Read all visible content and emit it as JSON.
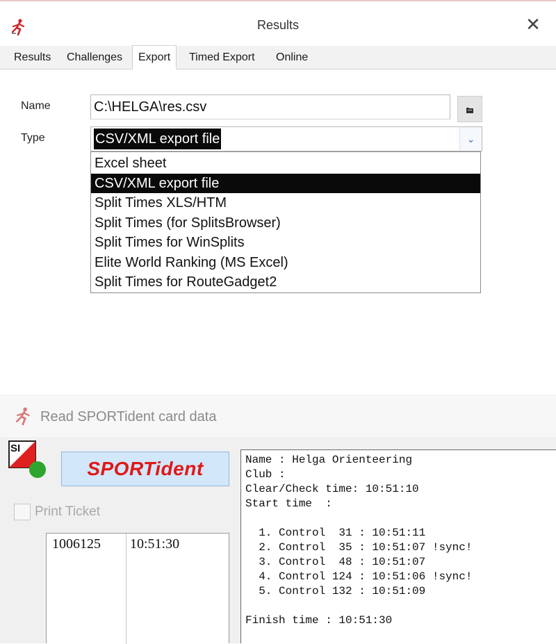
{
  "results_window": {
    "title": "Results",
    "close_symbol": "✕",
    "tabs": [
      {
        "label": "Results"
      },
      {
        "label": "Challenges"
      },
      {
        "label": "Export"
      },
      {
        "label": "Timed Export"
      },
      {
        "label": "Online"
      }
    ],
    "active_tab": "Export",
    "name_label": "Name",
    "name_value": "C:\\HELGA\\res.csv",
    "browse_icon": "folder-icon",
    "type_label": "Type",
    "type_value": "CSV/XML export file",
    "type_options": [
      "Excel sheet",
      "CSV/XML export file",
      "Split Times XLS/HTM",
      "Split Times (for SplitsBrowser)",
      "Split Times for WinSplits",
      "Elite World Ranking (MS Excel)",
      "Split Times for RouteGadget2"
    ],
    "selected_option": "CSV/XML export file"
  },
  "read_window": {
    "title": "Read SPORTident card data",
    "si_logo_text": "SI",
    "sportident_button": "SPORTident",
    "print_ticket_label": "Print Ticket",
    "print_ticket_checked": false,
    "cards": [
      {
        "number": "1006125",
        "time": "10:51:30"
      }
    ],
    "readout_lines": [
      "Name : Helga Orienteering",
      "Club :",
      "Clear/Check time: 10:51:10",
      "Start time  :",
      "",
      "  1. Control  31 : 10:51:11",
      "  2. Control  35 : 10:51:07 !sync!",
      "  3. Control  48 : 10:51:07",
      "  4. Control 124 : 10:51:06 !sync!",
      "  5. Control 132 : 10:51:09",
      "",
      "Finish time : 10:51:30"
    ]
  },
  "colors": {
    "selection_bg": "#0a0a0a",
    "sportident_red": "#e01818",
    "sportident_button_bg": "#d2e7f9",
    "si_green": "#2ea52e"
  }
}
